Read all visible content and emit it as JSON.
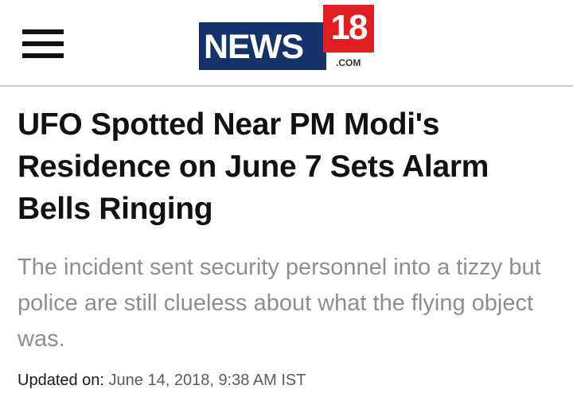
{
  "header": {
    "menu_icon": "hamburger-menu-icon",
    "logo": {
      "word": "NEWS",
      "number": "18",
      "suffix": ".COM",
      "colors": {
        "box": "#15336b",
        "number_box": "#e02020"
      }
    }
  },
  "article": {
    "headline": "UFO Spotted Near PM Modi's Residence on June 7 Sets Alarm Bells Ringing",
    "subheadline": "The incident sent security personnel into a tizzy but police are still clueless about what the flying object was.",
    "updated_label": "Updated on:",
    "updated_value": "June 14, 2018, 9:38 AM IST"
  }
}
